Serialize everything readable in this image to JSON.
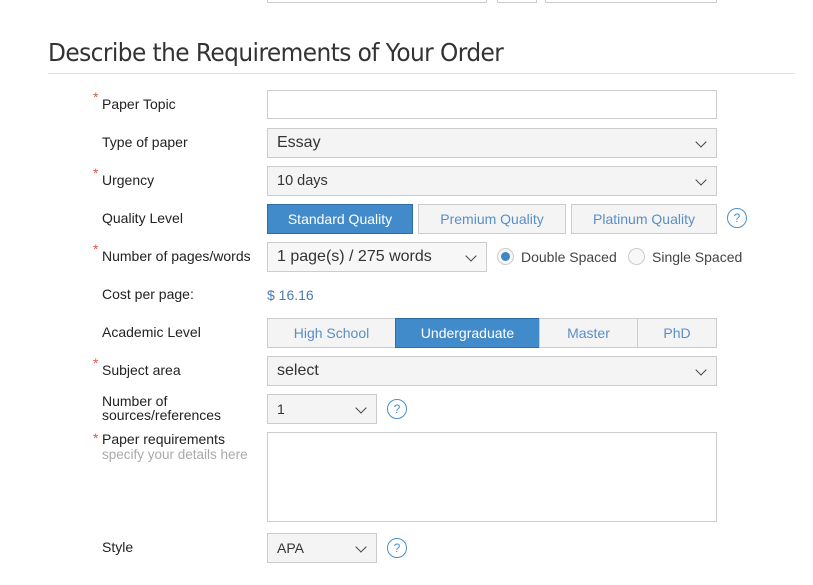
{
  "section_title": "Describe the Requirements of Your Order",
  "required_marker": "*",
  "fields": {
    "paper_topic": {
      "label": "Paper Topic",
      "value": "",
      "required": true
    },
    "type_of_paper": {
      "label": "Type of paper",
      "selected": "Essay"
    },
    "urgency": {
      "label": "Urgency",
      "selected": "10 days",
      "required": true
    },
    "quality_level": {
      "label": "Quality Level",
      "options": [
        "Standard Quality",
        "Premium Quality",
        "Platinum Quality"
      ],
      "selected": "Standard Quality"
    },
    "pages": {
      "label": "Number of pages/words",
      "selected": "1 page(s) / 275 words",
      "required": true,
      "spacing_options": [
        "Double Spaced",
        "Single Spaced"
      ],
      "spacing_selected": "Double Spaced"
    },
    "cost_per_page": {
      "label": "Cost per page:",
      "value": "$ 16.16"
    },
    "academic_level": {
      "label": "Academic Level",
      "options": [
        "High School",
        "Undergraduate",
        "Master",
        "PhD"
      ],
      "selected": "Undergraduate"
    },
    "subject_area": {
      "label": "Subject area",
      "selected": "select",
      "required": true
    },
    "sources": {
      "label_line1": "Number of",
      "label_line2": "sources/references",
      "selected": "1"
    },
    "paper_requirements": {
      "label": "Paper requirements",
      "hint": "specify your details here",
      "value": "",
      "required": true
    },
    "style": {
      "label": "Style",
      "selected": "APA"
    }
  },
  "help_icon_glyph": "?",
  "colors": {
    "accent": "#428bca",
    "required": "#e2574c",
    "link_text": "#5a8fc6"
  }
}
